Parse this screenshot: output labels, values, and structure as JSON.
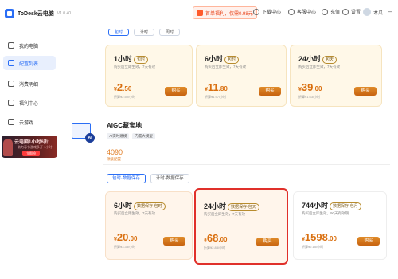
{
  "app": {
    "title": "ToDesk云电脑",
    "version": "V1.0.40"
  },
  "topbar": {
    "promo": "首单福利，仅需0.98元",
    "download": "下载中心",
    "service": "客服中心",
    "recharge": "充值",
    "settings": "设置",
    "user": "木瓜"
  },
  "sidebar": {
    "items": [
      {
        "label": "我的电脑"
      },
      {
        "label": "配置列表"
      },
      {
        "label": "消费明细"
      },
      {
        "label": "福利中心"
      },
      {
        "label": "云游戏"
      }
    ],
    "banner": {
      "title": "云电脑1小时6折",
      "sub": "助力春节游戏多开 1小时",
      "btn": "立即抢"
    }
  },
  "top_section": {
    "tabs": [
      "包时",
      "计时",
      "周时"
    ],
    "cards": [
      {
        "title": "1小时",
        "tag": "包时",
        "desc": "购买后立即生效，7天有效",
        "cur": "¥",
        "num": "2",
        "dec": ".50",
        "unit": "折算¥2.50/小时",
        "btn": "购买"
      },
      {
        "title": "6小时",
        "tag": "包时",
        "desc": "购买后立即生效，7天有效",
        "cur": "¥",
        "num": "11",
        "dec": ".80",
        "unit": "折算¥1.97/小时",
        "btn": "购买"
      },
      {
        "title": "24小时",
        "tag": "包天",
        "desc": "购买后立即生效，7天有效",
        "cur": "¥",
        "num": "39",
        "dec": ".00",
        "unit": "折算¥1.63/小时",
        "btn": "购买"
      }
    ]
  },
  "aigc": {
    "title": "AIGC藏宝地",
    "tags": [
      "AI实时建模",
      "内置大模型"
    ],
    "number": "4090",
    "number_sub": "顶级配置",
    "options": [
      "包时·数据保存",
      "计时·数据保存"
    ],
    "cards": [
      {
        "title": "6小时",
        "tag": "数据保存·包时",
        "desc": "购买后立即生效，7天有效",
        "cur": "¥",
        "num": "20",
        "dec": ".00",
        "unit": "折算¥3.33/小时",
        "btn": "购买"
      },
      {
        "title": "24小时",
        "tag": "数据保存·包天",
        "desc": "购买后立即生效，7天有效",
        "cur": "¥",
        "num": "68",
        "dec": ".00",
        "unit": "折算¥2.83/小时",
        "btn": "购买"
      },
      {
        "title": "744小时",
        "tag": "数据保存·包月",
        "desc": "购买后立即生效，90天有效期",
        "cur": "¥",
        "num": "1598",
        "dec": ".00",
        "unit": "折算¥2.15/小时",
        "btn": "购买"
      }
    ]
  },
  "colors": {
    "accent": "#2a6ef5",
    "price": "#d96f0f",
    "selected_border": "#e0302a"
  }
}
